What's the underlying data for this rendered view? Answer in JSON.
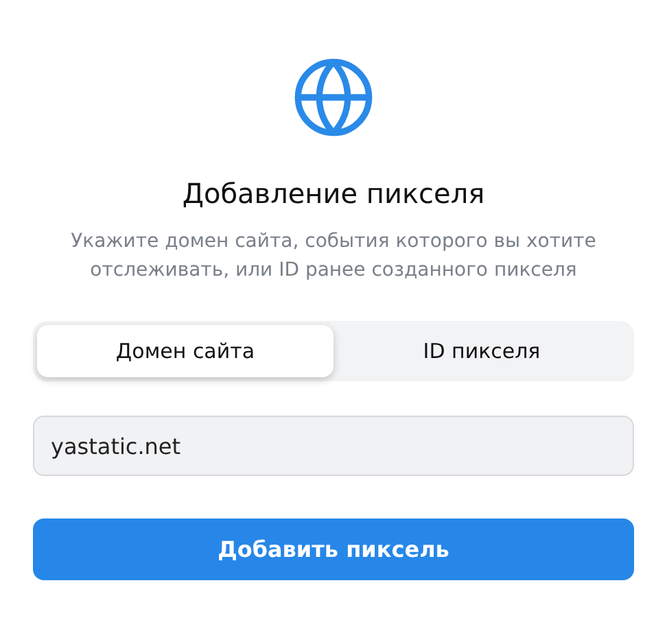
{
  "title": "Добавление пикселя",
  "subtitle": "Укажите домен сайта, события которого вы хотите отслеживать, или ID ранее созданного пикселя",
  "tabs": [
    {
      "label": "Домен сайта",
      "selected": true
    },
    {
      "label": "ID пикселя",
      "selected": false
    }
  ],
  "field": {
    "value": "yastatic.net"
  },
  "button": "Добавить пиксель"
}
